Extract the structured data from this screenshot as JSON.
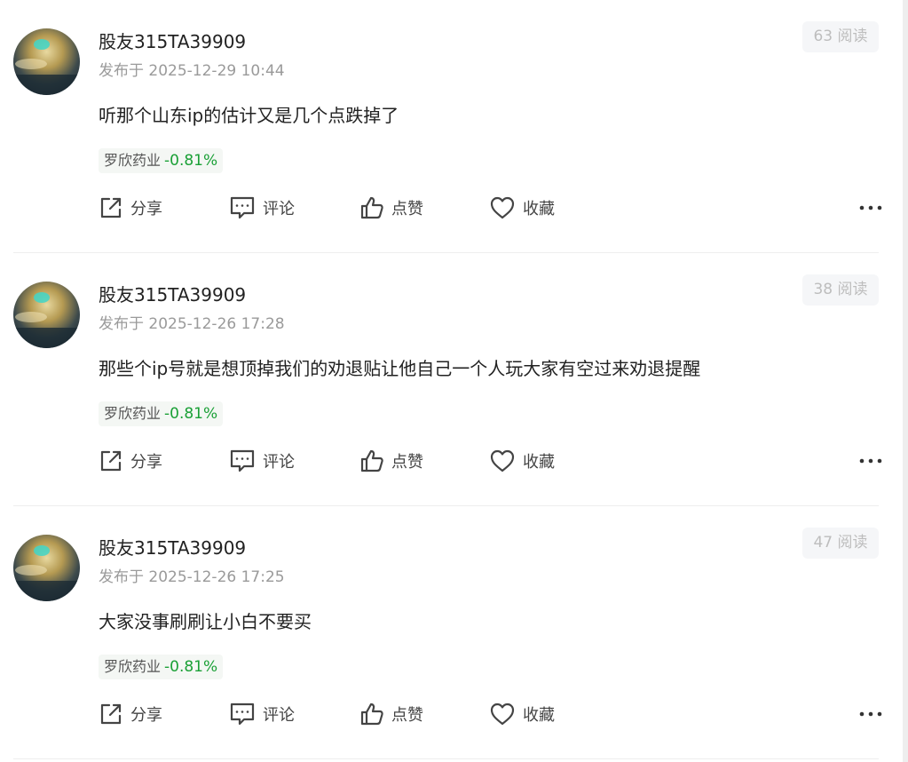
{
  "posts": [
    {
      "username": "股友315TA39909",
      "timestamp": "发布于 2025-12-29 10:44",
      "views": "63 阅读",
      "content": "听那个山东ip的估计又是几个点跌掉了",
      "stock_name": "罗欣药业",
      "stock_change": "-0.81%"
    },
    {
      "username": "股友315TA39909",
      "timestamp": "发布于 2025-12-26 17:28",
      "views": "38 阅读",
      "content": "那些个ip号就是想顶掉我们的劝退贴让他自己一个人玩大家有空过来劝退提醒",
      "stock_name": "罗欣药业",
      "stock_change": "-0.81%"
    },
    {
      "username": "股友315TA39909",
      "timestamp": "发布于 2025-12-26 17:25",
      "views": "47 阅读",
      "content": "大家没事刷刷让小白不要买",
      "stock_name": "罗欣药业",
      "stock_change": "-0.81%"
    }
  ],
  "actions": {
    "share": "分享",
    "comment": "评论",
    "like": "点赞",
    "favorite": "收藏"
  },
  "colors": {
    "change_negative": "#1aa036",
    "muted_text": "#9a9a9a",
    "badge_bg": "#f5f6f8"
  },
  "icons": {
    "share": "share-icon",
    "comment": "comment-icon",
    "like": "thumbs-up-icon",
    "favorite": "heart-icon",
    "more": "more-dots-icon"
  }
}
